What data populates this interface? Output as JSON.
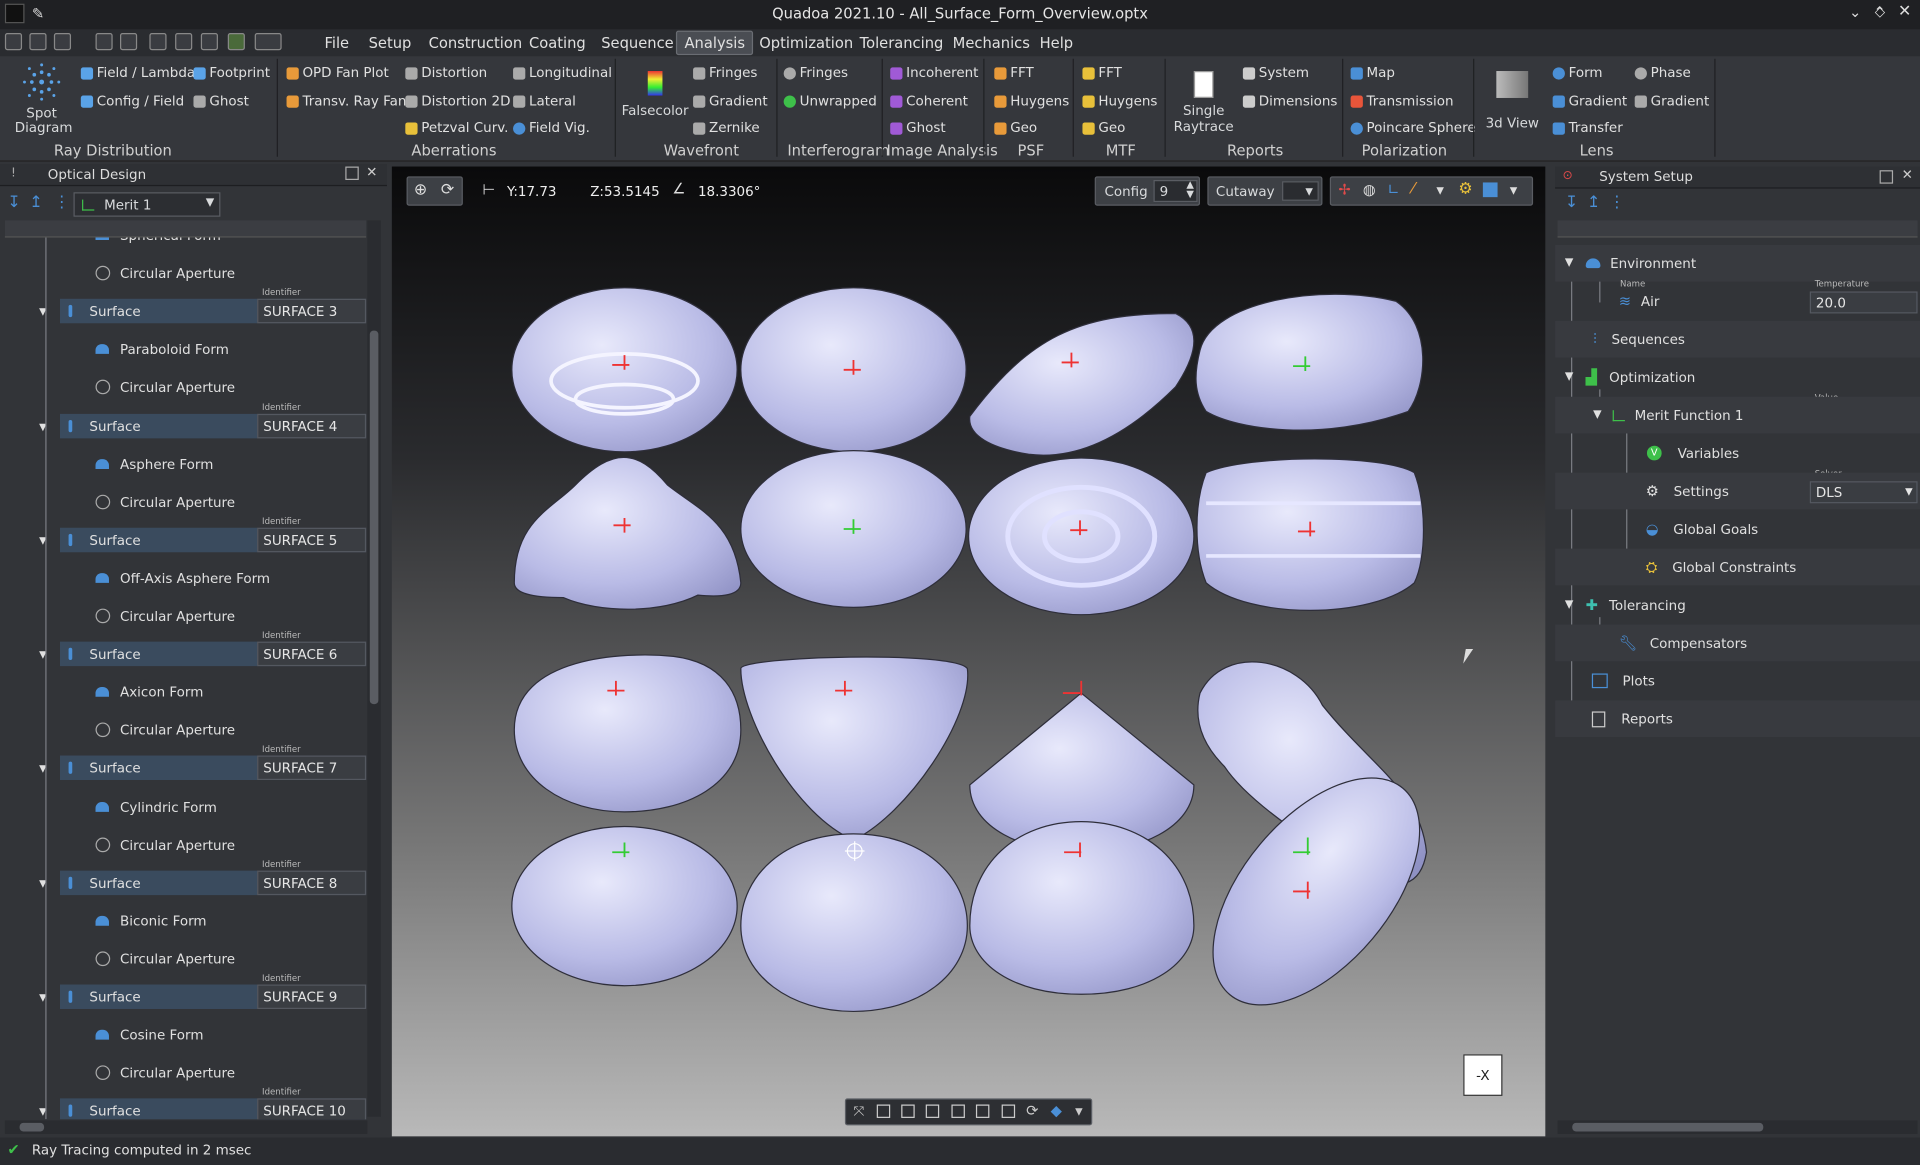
{
  "window": {
    "title": "Quadoa 2021.10 - All_Surface_Form_Overview.optx"
  },
  "menu": [
    "File",
    "Setup",
    "Construction",
    "Coating",
    "Sequence",
    "Analysis",
    "Optimization",
    "Tolerancing",
    "Mechanics",
    "Help"
  ],
  "menu_active": "Analysis",
  "ribbon": {
    "spot": "Spot Diagram",
    "field_lambda": "Field / Lambda",
    "config_field": "Config / Field",
    "footprint": "Footprint",
    "ghost": "Ghost",
    "group_raydist": "Ray Distribution",
    "opd": "OPD Fan Plot",
    "transv": "Transv. Ray Fan",
    "distortion": "Distortion",
    "distortion2d": "Distortion 2D",
    "petzval": "Petzval Curv.",
    "longitudinal": "Longitudinal",
    "lateral": "Lateral",
    "fieldvig": "Field Vig.",
    "group_aberr": "Aberrations",
    "falsecolor": "Falsecolor",
    "fringes": "Fringes",
    "gradient": "Gradient",
    "zernike": "Zernike",
    "group_wavefront": "Wavefront",
    "ifringes": "Fringes",
    "unwrapped": "Unwrapped",
    "group_interf": "Interferogram",
    "incoherent": "Incoherent",
    "coherent": "Coherent",
    "ia_ghost": "Ghost",
    "group_ia": "Image Analysis",
    "psf_fft": "FFT",
    "psf_huygens": "Huygens",
    "psf_geo": "Geo",
    "group_psf": "PSF",
    "mtf_fft": "FFT",
    "mtf_huygens": "Huygens",
    "mtf_geo": "Geo",
    "group_mtf": "MTF",
    "single_raytrace": "Single Raytrace",
    "system": "System",
    "dimensions": "Dimensions",
    "group_reports": "Reports",
    "map": "Map",
    "transmission": "Transmission",
    "poincare": "Poincare Sphere",
    "group_pol": "Polarization",
    "view3d": "3d View",
    "form": "Form",
    "lgradient": "Gradient",
    "transfer": "Transfer",
    "phase": "Phase",
    "pgradient": "Gradient",
    "group_lens": "Lens"
  },
  "left_panel": {
    "title": "Optical Design",
    "merit": "Merit 1",
    "rows": [
      {
        "type": "child",
        "label": "Spherical Form"
      },
      {
        "type": "child",
        "label": "Circular Aperture"
      },
      {
        "type": "surface",
        "label": "Surface",
        "id": "SURFACE 3"
      },
      {
        "type": "child",
        "label": "Paraboloid Form"
      },
      {
        "type": "child",
        "label": "Circular Aperture"
      },
      {
        "type": "surface",
        "label": "Surface",
        "id": "SURFACE 4"
      },
      {
        "type": "child",
        "label": "Asphere Form"
      },
      {
        "type": "child",
        "label": "Circular Aperture"
      },
      {
        "type": "surface",
        "label": "Surface",
        "id": "SURFACE 5"
      },
      {
        "type": "child",
        "label": "Off-Axis Asphere Form"
      },
      {
        "type": "child",
        "label": "Circular Aperture"
      },
      {
        "type": "surface",
        "label": "Surface",
        "id": "SURFACE 6"
      },
      {
        "type": "child",
        "label": "Axicon Form"
      },
      {
        "type": "child",
        "label": "Circular Aperture"
      },
      {
        "type": "surface",
        "label": "Surface",
        "id": "SURFACE 7"
      },
      {
        "type": "child",
        "label": "Cylindric Form"
      },
      {
        "type": "child",
        "label": "Circular Aperture"
      },
      {
        "type": "surface",
        "label": "Surface",
        "id": "SURFACE 8"
      },
      {
        "type": "child",
        "label": "Biconic Form"
      },
      {
        "type": "child",
        "label": "Circular Aperture"
      },
      {
        "type": "surface",
        "label": "Surface",
        "id": "SURFACE 9"
      },
      {
        "type": "child",
        "label": "Cosine Form"
      },
      {
        "type": "child",
        "label": "Circular Aperture"
      },
      {
        "type": "surface",
        "label": "Surface",
        "id": "SURFACE 10"
      }
    ],
    "identifier_label": "Identifier"
  },
  "viewport": {
    "y": "Y:17.73",
    "z": "Z:53.5145",
    "angle": "18.3306°",
    "config_label": "Config",
    "config_value": "9",
    "cutaway": "Cutaway",
    "axis_btn": "-X"
  },
  "right_panel": {
    "title": "System Setup",
    "environment": "Environment",
    "name_label": "Name",
    "air": "Air",
    "temp_label": "Temperature",
    "temp": "20.0",
    "sequences": "Sequences",
    "optimization": "Optimization",
    "value_label": "Value",
    "merit": "Merit Function 1",
    "variables": "Variables",
    "solver_label": "Solver",
    "settings": "Settings",
    "solver": "DLS",
    "global_goals": "Global Goals",
    "global_constraints": "Global Constraints",
    "tolerancing": "Tolerancing",
    "compensators": "Compensators",
    "plots": "Plots",
    "reports": "Reports"
  },
  "status": "Ray Tracing computed in 2 msec",
  "colors": {
    "accent": "#4a8fd6",
    "selection": "#3a4b5e",
    "surface_shape": "#b9bbe6"
  }
}
